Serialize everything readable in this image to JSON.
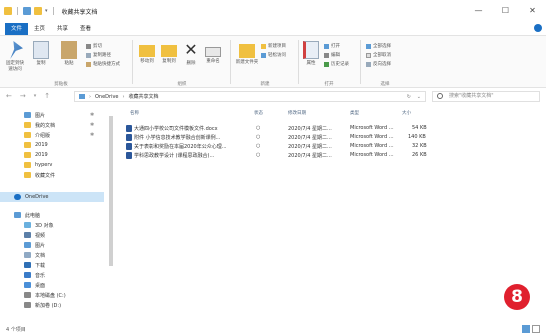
{
  "window": {
    "title": "收藏共享文档",
    "controls": [
      "—",
      "☐",
      "✕"
    ]
  },
  "ribbon_tabs": [
    "文件",
    "主页",
    "共享",
    "查看"
  ],
  "ribbon": {
    "clipboard": {
      "buttons": [
        "固定到快速访问",
        "复制",
        "粘贴"
      ],
      "small": [
        "剪切",
        "复制路径",
        "粘贴快捷方式"
      ],
      "label": "剪贴板"
    },
    "organize": {
      "buttons": [
        "移动到",
        "复制到",
        "删除",
        "重命名"
      ],
      "label": "组织"
    },
    "new": {
      "buttons": [
        "新建文件夹"
      ],
      "small": [
        "新建项目",
        "轻松访问"
      ],
      "label": "新建"
    },
    "open": {
      "buttons": [
        "属性"
      ],
      "small": [
        "打开",
        "编辑",
        "历史记录"
      ],
      "label": "打开"
    },
    "select": {
      "small": [
        "全部选择",
        "全部取消",
        "反向选择"
      ],
      "label": "选择"
    }
  },
  "address": {
    "path": [
      "OneDrive",
      "收藏共享文档"
    ],
    "search_placeholder": "搜索\"收藏共享文档\""
  },
  "nav_pane": {
    "items": [
      {
        "label": "图片",
        "icon": "pictures-icon",
        "pinned": true
      },
      {
        "label": "我的文档",
        "icon": "folder-icon",
        "pinned": true
      },
      {
        "label": "介绍版",
        "icon": "folder-icon",
        "pinned": true
      },
      {
        "label": "2019",
        "icon": "folder-icon"
      },
      {
        "label": "2019",
        "icon": "folder-icon"
      },
      {
        "label": "hyperv",
        "icon": "folder-icon"
      },
      {
        "label": "收藏文件",
        "icon": "folder-icon"
      },
      {
        "label": "OneDrive",
        "icon": "onedrive-icon",
        "selected": true
      },
      {
        "label": "此电脑",
        "icon": "computer-icon"
      },
      {
        "label": "3D 对象",
        "icon": "3d-objects-icon"
      },
      {
        "label": "视频",
        "icon": "video-icon"
      },
      {
        "label": "图片",
        "icon": "pictures-icon"
      },
      {
        "label": "文档",
        "icon": "documents-icon"
      },
      {
        "label": "下载",
        "icon": "downloads-icon"
      },
      {
        "label": "音乐",
        "icon": "music-icon"
      },
      {
        "label": "桌面",
        "icon": "desktop-icon"
      },
      {
        "label": "本地磁盘 (C:)",
        "icon": "drive-icon"
      },
      {
        "label": "新加卷 (D:)",
        "icon": "drive-icon"
      }
    ]
  },
  "file_list": {
    "columns": [
      "名称",
      "状态",
      "修改日期",
      "类型",
      "大小"
    ],
    "rows": [
      {
        "name": "大通四小学校公司文件模板文件.docx",
        "status": "○",
        "date": "2020/7/4 星期二...",
        "type": "Microsoft Word ...",
        "size": "54 KB"
      },
      {
        "name": "附件 小学信息技术教学融合创新课例...",
        "status": "○",
        "date": "2020/7/4 星期二...",
        "type": "Microsoft Word ...",
        "size": "140 KB"
      },
      {
        "name": "关于表彰和奖励在本届2020年公众心理...",
        "status": "○",
        "date": "2020/7/4 星期二...",
        "type": "Microsoft Word ...",
        "size": "32 KB"
      },
      {
        "name": "学科思政教学设计 (课程思政融合)...",
        "status": "○",
        "date": "2020/7/4 星期二...",
        "type": "Microsoft Word ...",
        "size": "26 KB"
      }
    ]
  },
  "status_bar": {
    "count": "4 个项目"
  },
  "badge": "8",
  "colors": {
    "accent": "#1a6fc4",
    "word": "#2b579a",
    "badge": "#e0202e",
    "folder": "#f0c040"
  }
}
